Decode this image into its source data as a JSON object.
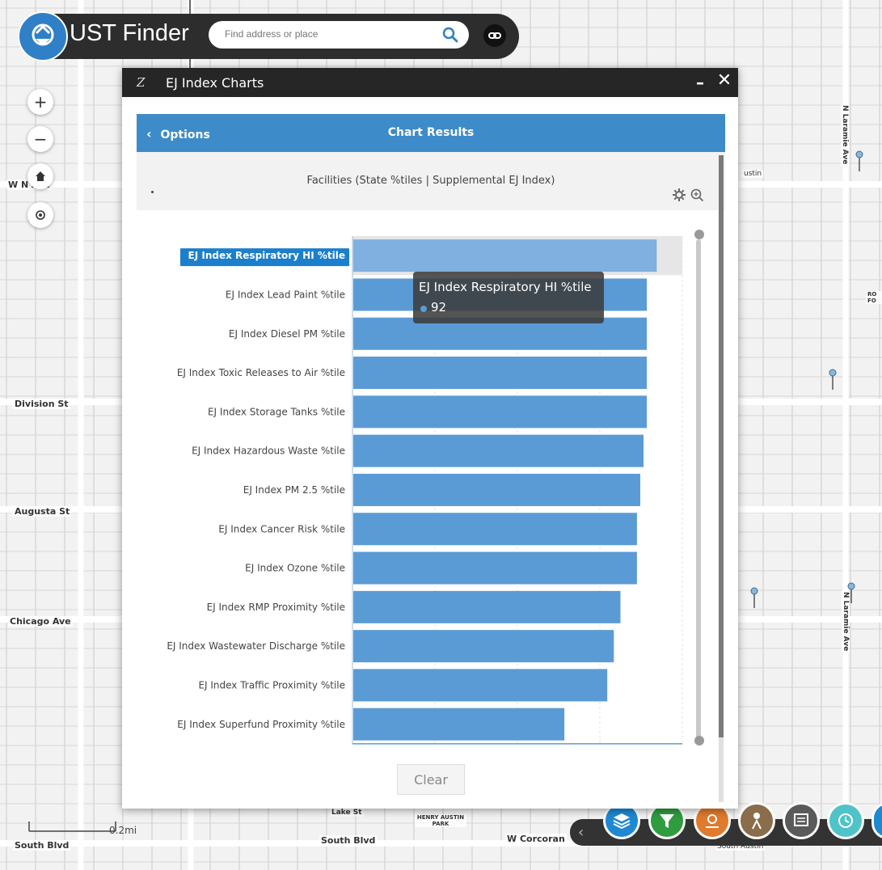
{
  "app": {
    "title": "UST Finder",
    "search_placeholder": "Find address or place"
  },
  "map": {
    "street_labels": [
      {
        "text": "W N  Ave",
        "name": "street-label-w-north-ave"
      },
      {
        "text": "Division St",
        "name": "street-label-division-st"
      },
      {
        "text": "Augusta St",
        "name": "street-label-augusta-st"
      },
      {
        "text": "Chicago Ave",
        "name": "street-label-chicago-ave"
      },
      {
        "text": "South Blvd",
        "name": "street-label-south-blvd-left"
      },
      {
        "text": "South Blvd",
        "name": "street-label-south-blvd"
      },
      {
        "text": "W Corcoran",
        "name": "street-label-w-corcoran"
      },
      {
        "text": "Lake St",
        "name": "street-label-lake-st"
      },
      {
        "text": "HENRY AUSTIN PARK",
        "name": "park-label-henry-austin"
      },
      {
        "text": "N Laramie Ave",
        "name": "street-label-n-laramie-ave-top"
      },
      {
        "text": "N Laramie Ave",
        "name": "street-label-n-laramie-ave-bottom"
      },
      {
        "text": "ustin",
        "name": "street-label-austin"
      },
      {
        "text": "RO FO",
        "name": "map-label-ro-fo"
      },
      {
        "text": "South Austin",
        "name": "street-label-south-austin"
      }
    ],
    "scale_label": "0.2mi"
  },
  "panel": {
    "title": "EJ Index Charts",
    "minimize_glyph": "–",
    "close_glyph": "✕",
    "options_label": "Options",
    "options_glyph": "‹",
    "header_title": "Chart Results",
    "subtitle": "Facilities (State %tiles | Supplemental EJ Index)",
    "clear_label": "Clear"
  },
  "tooltip": {
    "label": "EJ Index Respiratory HI %tile",
    "value": "92"
  },
  "chart_data": {
    "type": "bar",
    "orientation": "horizontal",
    "title": "",
    "xlabel": "",
    "ylabel": "",
    "xlim": [
      0,
      100
    ],
    "bar_color": "#5b9bd5",
    "highlight_color": "#7fb0e0",
    "label_highlight_color": "#1b7fcc",
    "highlighted_index": 0,
    "categories": [
      "EJ Index Respiratory HI %tile",
      "EJ Index Lead Paint %tile",
      "EJ Index Diesel PM %tile",
      "EJ Index Toxic Releases to Air %tile",
      "EJ Index Storage Tanks %tile",
      "EJ Index Hazardous Waste %tile",
      "EJ Index PM 2.5 %tile",
      "EJ Index Cancer Risk %tile",
      "EJ Index Ozone %tile",
      "EJ Index RMP Proximity %tile",
      "EJ Index Wastewater Discharge %tile",
      "EJ Index Traffic Proximity %tile",
      "EJ Index Superfund Proximity %tile"
    ],
    "values": [
      92,
      89,
      89,
      89,
      89,
      88,
      87,
      86,
      86,
      81,
      79,
      77,
      64
    ]
  },
  "toolbar": {
    "buttons": [
      {
        "name": "layers-tool-button",
        "color": "#1e88d2"
      },
      {
        "name": "filter-tool-button",
        "color": "#2e9c3f"
      },
      {
        "name": "analysis-tool-button",
        "color": "#e07a2c"
      },
      {
        "name": "location-tool-button",
        "color": "#8a6d4b"
      },
      {
        "name": "report-tool-button",
        "color": "#5a5a5a"
      },
      {
        "name": "history-tool-button",
        "color": "#4fc3c8"
      },
      {
        "name": "extra-tool-button",
        "color": "#1e88d2"
      }
    ],
    "collapse_glyph": "‹"
  },
  "colors": {
    "header_bg": "#2d2d2d",
    "accent": "#3d8bc8",
    "titlebar": "#262626"
  }
}
